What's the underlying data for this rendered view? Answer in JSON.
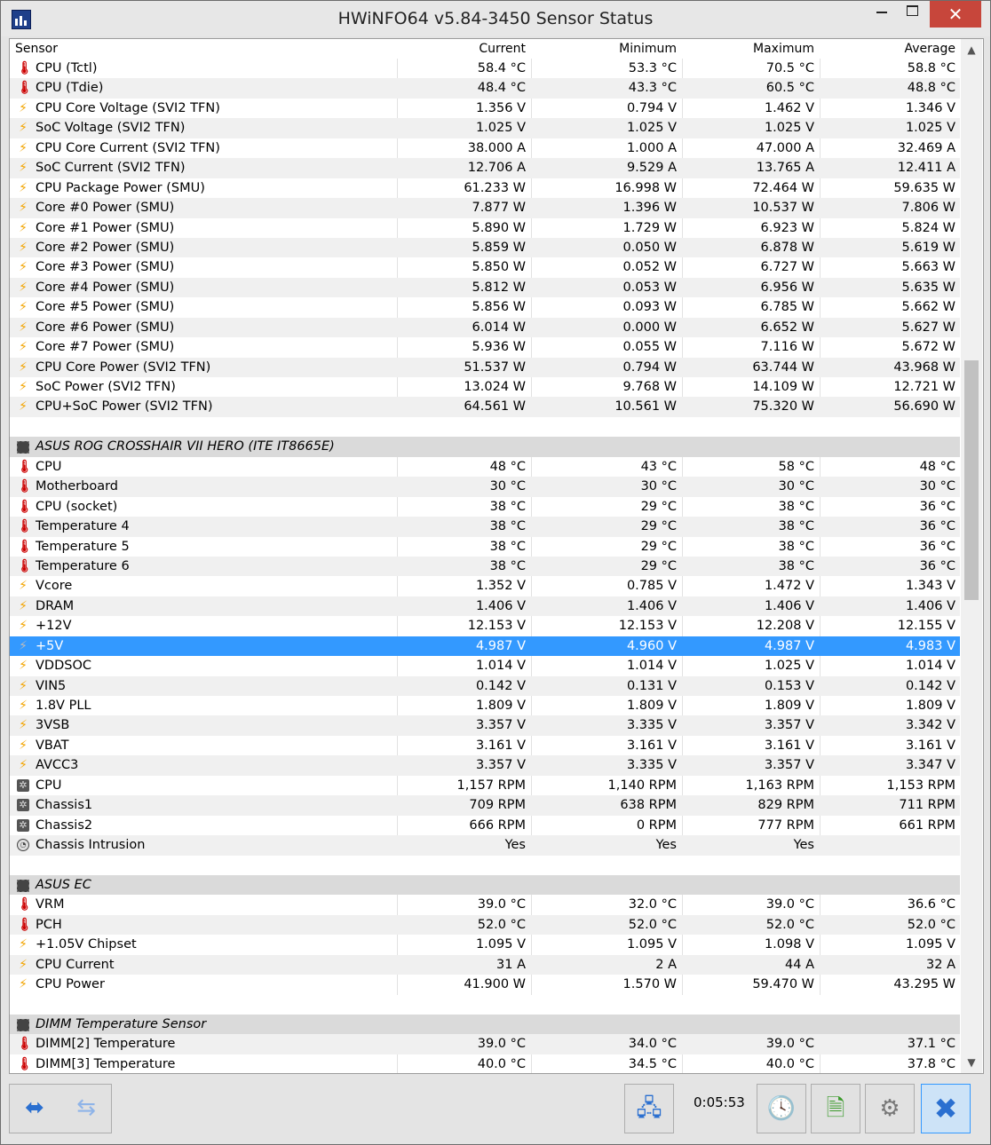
{
  "window": {
    "title": "HWiNFO64 v5.84-3450 Sensor Status",
    "minimize_label": "",
    "maximize_label": "",
    "close_label": "✕"
  },
  "columns": {
    "sensor": "Sensor",
    "current": "Current",
    "minimum": "Minimum",
    "maximum": "Maximum",
    "average": "Average"
  },
  "rows": [
    {
      "type": "sensor",
      "icon": "thermometer-icon",
      "name": "CPU (Tctl)",
      "cur": "58.4 °C",
      "min": "53.3 °C",
      "max": "70.5 °C",
      "avg": "58.8 °C"
    },
    {
      "type": "sensor",
      "icon": "thermometer-icon",
      "name": "CPU (Tdie)",
      "cur": "48.4 °C",
      "min": "43.3 °C",
      "max": "60.5 °C",
      "avg": "48.8 °C"
    },
    {
      "type": "sensor",
      "icon": "lightning-icon",
      "name": "CPU Core Voltage (SVI2 TFN)",
      "cur": "1.356 V",
      "min": "0.794 V",
      "max": "1.462 V",
      "avg": "1.346 V"
    },
    {
      "type": "sensor",
      "icon": "lightning-icon",
      "name": "SoC Voltage (SVI2 TFN)",
      "cur": "1.025 V",
      "min": "1.025 V",
      "max": "1.025 V",
      "avg": "1.025 V"
    },
    {
      "type": "sensor",
      "icon": "lightning-icon",
      "name": "CPU Core Current (SVI2 TFN)",
      "cur": "38.000 A",
      "min": "1.000 A",
      "max": "47.000 A",
      "avg": "32.469 A"
    },
    {
      "type": "sensor",
      "icon": "lightning-icon",
      "name": "SoC Current (SVI2 TFN)",
      "cur": "12.706 A",
      "min": "9.529 A",
      "max": "13.765 A",
      "avg": "12.411 A"
    },
    {
      "type": "sensor",
      "icon": "lightning-icon",
      "name": "CPU Package Power (SMU)",
      "cur": "61.233 W",
      "min": "16.998 W",
      "max": "72.464 W",
      "avg": "59.635 W"
    },
    {
      "type": "sensor",
      "icon": "lightning-icon",
      "name": "Core #0 Power (SMU)",
      "cur": "7.877 W",
      "min": "1.396 W",
      "max": "10.537 W",
      "avg": "7.806 W"
    },
    {
      "type": "sensor",
      "icon": "lightning-icon",
      "name": "Core #1 Power (SMU)",
      "cur": "5.890 W",
      "min": "1.729 W",
      "max": "6.923 W",
      "avg": "5.824 W"
    },
    {
      "type": "sensor",
      "icon": "lightning-icon",
      "name": "Core #2 Power (SMU)",
      "cur": "5.859 W",
      "min": "0.050 W",
      "max": "6.878 W",
      "avg": "5.619 W"
    },
    {
      "type": "sensor",
      "icon": "lightning-icon",
      "name": "Core #3 Power (SMU)",
      "cur": "5.850 W",
      "min": "0.052 W",
      "max": "6.727 W",
      "avg": "5.663 W"
    },
    {
      "type": "sensor",
      "icon": "lightning-icon",
      "name": "Core #4 Power (SMU)",
      "cur": "5.812 W",
      "min": "0.053 W",
      "max": "6.956 W",
      "avg": "5.635 W"
    },
    {
      "type": "sensor",
      "icon": "lightning-icon",
      "name": "Core #5 Power (SMU)",
      "cur": "5.856 W",
      "min": "0.093 W",
      "max": "6.785 W",
      "avg": "5.662 W"
    },
    {
      "type": "sensor",
      "icon": "lightning-icon",
      "name": "Core #6 Power (SMU)",
      "cur": "6.014 W",
      "min": "0.000 W",
      "max": "6.652 W",
      "avg": "5.627 W"
    },
    {
      "type": "sensor",
      "icon": "lightning-icon",
      "name": "Core #7 Power (SMU)",
      "cur": "5.936 W",
      "min": "0.055 W",
      "max": "7.116 W",
      "avg": "5.672 W"
    },
    {
      "type": "sensor",
      "icon": "lightning-icon",
      "name": "CPU Core Power (SVI2 TFN)",
      "cur": "51.537 W",
      "min": "0.794 W",
      "max": "63.744 W",
      "avg": "43.968 W"
    },
    {
      "type": "sensor",
      "icon": "lightning-icon",
      "name": "SoC Power (SVI2 TFN)",
      "cur": "13.024 W",
      "min": "9.768 W",
      "max": "14.109 W",
      "avg": "12.721 W"
    },
    {
      "type": "sensor",
      "icon": "lightning-icon",
      "name": "CPU+SoC Power (SVI2 TFN)",
      "cur": "64.561 W",
      "min": "10.561 W",
      "max": "75.320 W",
      "avg": "56.690 W"
    },
    {
      "type": "blank"
    },
    {
      "type": "group",
      "icon": "chip-icon",
      "name": "ASUS ROG CROSSHAIR VII HERO (ITE IT8665E)"
    },
    {
      "type": "sensor",
      "icon": "thermometer-icon",
      "name": "CPU",
      "cur": "48 °C",
      "min": "43 °C",
      "max": "58 °C",
      "avg": "48 °C"
    },
    {
      "type": "sensor",
      "icon": "thermometer-icon",
      "name": "Motherboard",
      "cur": "30 °C",
      "min": "30 °C",
      "max": "30 °C",
      "avg": "30 °C"
    },
    {
      "type": "sensor",
      "icon": "thermometer-icon",
      "name": "CPU (socket)",
      "cur": "38 °C",
      "min": "29 °C",
      "max": "38 °C",
      "avg": "36 °C"
    },
    {
      "type": "sensor",
      "icon": "thermometer-icon",
      "name": "Temperature 4",
      "cur": "38 °C",
      "min": "29 °C",
      "max": "38 °C",
      "avg": "36 °C"
    },
    {
      "type": "sensor",
      "icon": "thermometer-icon",
      "name": "Temperature 5",
      "cur": "38 °C",
      "min": "29 °C",
      "max": "38 °C",
      "avg": "36 °C"
    },
    {
      "type": "sensor",
      "icon": "thermometer-icon",
      "name": "Temperature 6",
      "cur": "38 °C",
      "min": "29 °C",
      "max": "38 °C",
      "avg": "36 °C"
    },
    {
      "type": "sensor",
      "icon": "lightning-icon",
      "name": "Vcore",
      "cur": "1.352 V",
      "min": "0.785 V",
      "max": "1.472 V",
      "avg": "1.343 V"
    },
    {
      "type": "sensor",
      "icon": "lightning-icon",
      "name": "DRAM",
      "cur": "1.406 V",
      "min": "1.406 V",
      "max": "1.406 V",
      "avg": "1.406 V"
    },
    {
      "type": "sensor",
      "icon": "lightning-icon",
      "name": "+12V",
      "cur": "12.153 V",
      "min": "12.153 V",
      "max": "12.208 V",
      "avg": "12.155 V"
    },
    {
      "type": "sensor",
      "icon": "lightning-icon",
      "name": "+5V",
      "cur": "4.987 V",
      "min": "4.960 V",
      "max": "4.987 V",
      "avg": "4.983 V",
      "selected": true
    },
    {
      "type": "sensor",
      "icon": "lightning-icon",
      "name": "VDDSOC",
      "cur": "1.014 V",
      "min": "1.014 V",
      "max": "1.025 V",
      "avg": "1.014 V"
    },
    {
      "type": "sensor",
      "icon": "lightning-icon",
      "name": "VIN5",
      "cur": "0.142 V",
      "min": "0.131 V",
      "max": "0.153 V",
      "avg": "0.142 V"
    },
    {
      "type": "sensor",
      "icon": "lightning-icon",
      "name": "1.8V PLL",
      "cur": "1.809 V",
      "min": "1.809 V",
      "max": "1.809 V",
      "avg": "1.809 V"
    },
    {
      "type": "sensor",
      "icon": "lightning-icon",
      "name": "3VSB",
      "cur": "3.357 V",
      "min": "3.335 V",
      "max": "3.357 V",
      "avg": "3.342 V"
    },
    {
      "type": "sensor",
      "icon": "lightning-icon",
      "name": "VBAT",
      "cur": "3.161 V",
      "min": "3.161 V",
      "max": "3.161 V",
      "avg": "3.161 V"
    },
    {
      "type": "sensor",
      "icon": "lightning-icon",
      "name": "AVCC3",
      "cur": "3.357 V",
      "min": "3.335 V",
      "max": "3.357 V",
      "avg": "3.347 V"
    },
    {
      "type": "sensor",
      "icon": "fan-icon",
      "name": "CPU",
      "cur": "1,157 RPM",
      "min": "1,140 RPM",
      "max": "1,163 RPM",
      "avg": "1,153 RPM"
    },
    {
      "type": "sensor",
      "icon": "fan-icon",
      "name": "Chassis1",
      "cur": "709 RPM",
      "min": "638 RPM",
      "max": "829 RPM",
      "avg": "711 RPM"
    },
    {
      "type": "sensor",
      "icon": "fan-icon",
      "name": "Chassis2",
      "cur": "666 RPM",
      "min": "0 RPM",
      "max": "777 RPM",
      "avg": "661 RPM"
    },
    {
      "type": "sensor",
      "icon": "intrusion-icon",
      "name": "Chassis Intrusion",
      "cur": "Yes",
      "min": "Yes",
      "max": "Yes",
      "avg": ""
    },
    {
      "type": "blank"
    },
    {
      "type": "group",
      "icon": "chip-icon",
      "name": "ASUS EC"
    },
    {
      "type": "sensor",
      "icon": "thermometer-icon",
      "name": "VRM",
      "cur": "39.0 °C",
      "min": "32.0 °C",
      "max": "39.0 °C",
      "avg": "36.6 °C"
    },
    {
      "type": "sensor",
      "icon": "thermometer-icon",
      "name": "PCH",
      "cur": "52.0 °C",
      "min": "52.0 °C",
      "max": "52.0 °C",
      "avg": "52.0 °C"
    },
    {
      "type": "sensor",
      "icon": "lightning-icon",
      "name": "+1.05V Chipset",
      "cur": "1.095 V",
      "min": "1.095 V",
      "max": "1.098 V",
      "avg": "1.095 V"
    },
    {
      "type": "sensor",
      "icon": "lightning-icon",
      "name": "CPU Current",
      "cur": "31 A",
      "min": "2 A",
      "max": "44 A",
      "avg": "32 A"
    },
    {
      "type": "sensor",
      "icon": "lightning-icon",
      "name": "CPU Power",
      "cur": "41.900 W",
      "min": "1.570 W",
      "max": "59.470 W",
      "avg": "43.295 W"
    },
    {
      "type": "blank"
    },
    {
      "type": "group",
      "icon": "chip-icon",
      "name": "DIMM Temperature Sensor"
    },
    {
      "type": "sensor",
      "icon": "thermometer-icon",
      "name": "DIMM[2] Temperature",
      "cur": "39.0 °C",
      "min": "34.0 °C",
      "max": "39.0 °C",
      "avg": "37.1 °C"
    },
    {
      "type": "sensor",
      "icon": "thermometer-icon",
      "name": "DIMM[3] Temperature",
      "cur": "40.0 °C",
      "min": "34.5 °C",
      "max": "40.0 °C",
      "avg": "37.8 °C"
    }
  ],
  "toolbar": {
    "timer": "0:05:53",
    "colors": {
      "accent": "#3399ff",
      "close": "#c7463b"
    }
  }
}
